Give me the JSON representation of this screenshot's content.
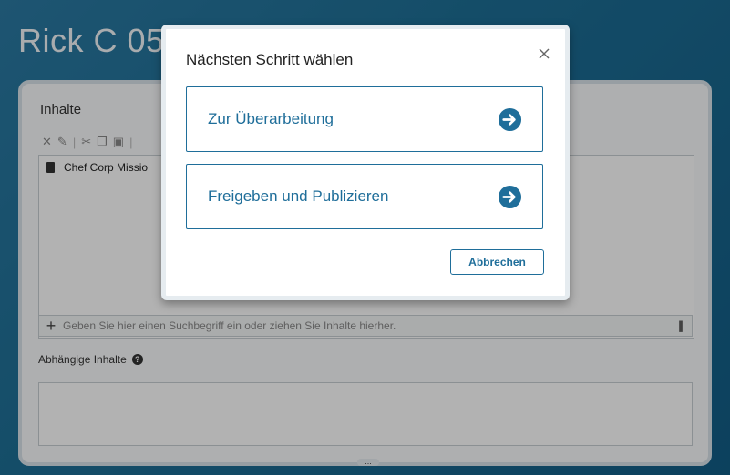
{
  "page": {
    "title": "Rick C 05."
  },
  "panel": {
    "section_title": "Inhalte",
    "content_item": "Chef Corp Missio",
    "search_placeholder": "Geben Sie hier einen Suchbegriff ein oder ziehen Sie Inhalte hierher.",
    "dependent_label": "Abhängige Inhalte",
    "help_glyph": "?",
    "add_glyph": "+",
    "grip_glyph": "..."
  },
  "modal": {
    "title": "Nächsten Schritt wählen",
    "choices": [
      {
        "label": "Zur Überarbeitung",
        "icon": "arrow-right-circle-icon"
      },
      {
        "label": "Freigeben und Publizieren",
        "icon": "arrow-right-circle-icon"
      }
    ],
    "cancel_label": "Abbrechen"
  },
  "colors": {
    "accent": "#1f6e9a",
    "background": "#1e6f96"
  }
}
